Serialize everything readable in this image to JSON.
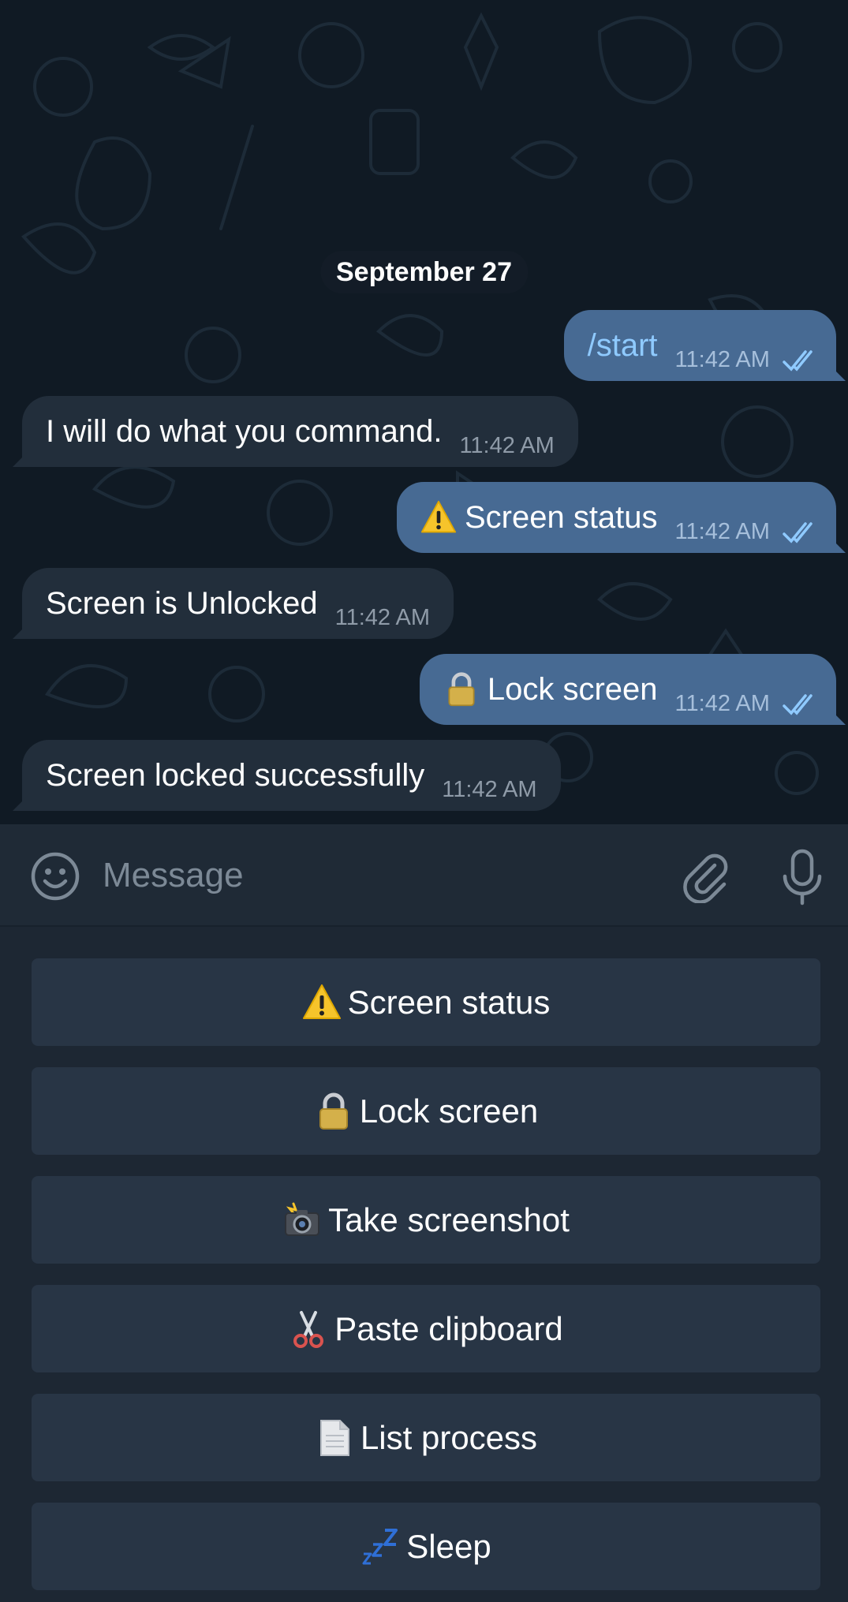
{
  "chat": {
    "date_chip": "September 27",
    "messages": [
      {
        "dir": "out",
        "text": "/start",
        "time": "11:42 AM",
        "emoji": "",
        "command": true
      },
      {
        "dir": "in",
        "text": "I will do what you command.",
        "time": "11:42 AM",
        "emoji": ""
      },
      {
        "dir": "out",
        "text": "Screen status",
        "time": "11:42 AM",
        "emoji": "warning-icon"
      },
      {
        "dir": "in",
        "text": "Screen is Unlocked",
        "time": "11:42 AM",
        "emoji": ""
      },
      {
        "dir": "out",
        "text": "Lock screen",
        "time": "11:42 AM",
        "emoji": "lock-icon"
      },
      {
        "dir": "in",
        "text": "Screen locked successfully",
        "time": "11:42 AM",
        "emoji": ""
      }
    ]
  },
  "composer": {
    "placeholder": "Message",
    "icons": [
      "smile-icon",
      "paperclip-icon",
      "microphone-icon"
    ]
  },
  "keyboard": {
    "buttons": [
      {
        "label": "Screen status",
        "icon": "warning-icon"
      },
      {
        "label": "Lock screen",
        "icon": "lock-icon"
      },
      {
        "label": "Take screenshot",
        "icon": "camera-flash-icon"
      },
      {
        "label": "Paste clipboard",
        "icon": "scissors-icon"
      },
      {
        "label": "List process",
        "icon": "document-icon"
      },
      {
        "label": "Sleep",
        "icon": "zzz-icon"
      }
    ]
  },
  "colors": {
    "chat_bg": "#101a24",
    "incoming_bubble": "#222e3b",
    "outgoing_bubble": "#476a93",
    "command_text": "#8fcaff",
    "keyboard_bg": "#1d2733",
    "keyboard_button": "#283545"
  }
}
